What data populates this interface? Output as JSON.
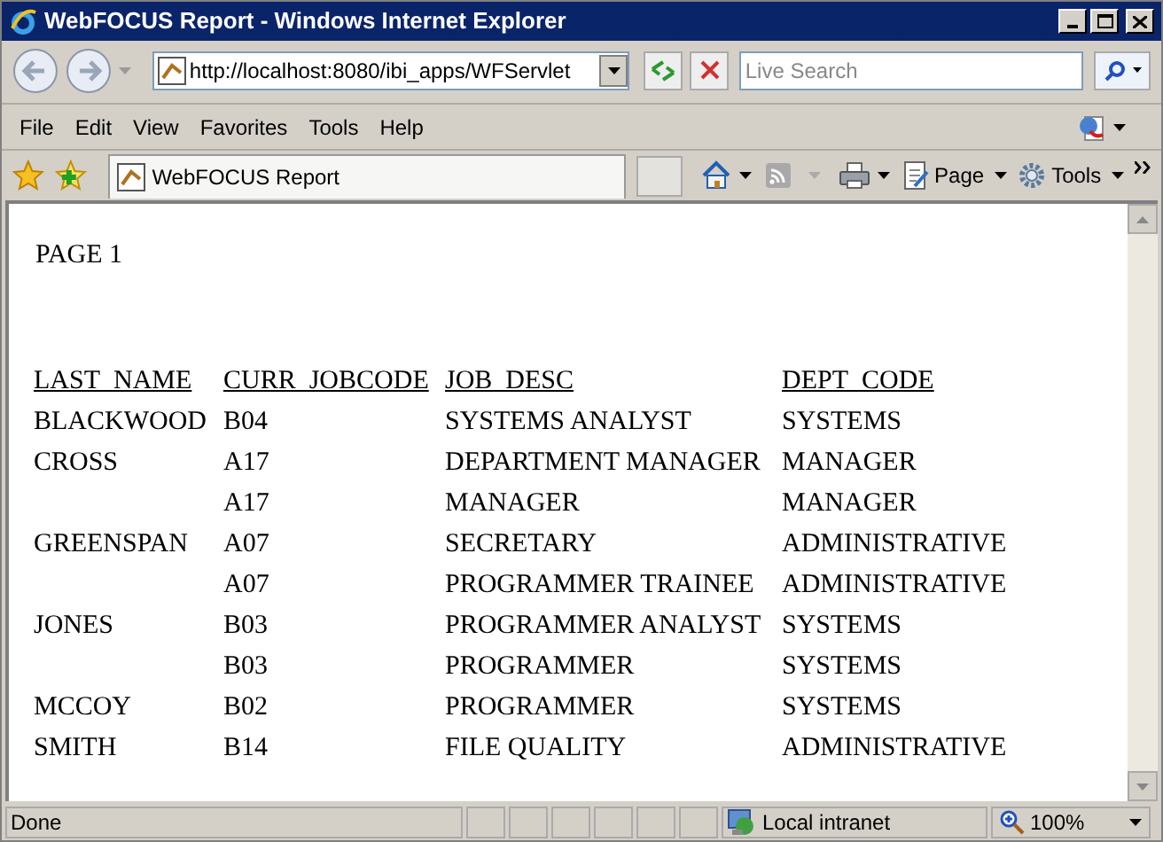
{
  "window": {
    "title": "WebFOCUS Report - Windows Internet Explorer"
  },
  "address_bar": {
    "value": "http://localhost:8080/ibi_apps/WFServlet"
  },
  "search": {
    "placeholder": "Live Search"
  },
  "menu": [
    "File",
    "Edit",
    "View",
    "Favorites",
    "Tools",
    "Help"
  ],
  "tab": {
    "label": "WebFOCUS Report"
  },
  "command_bar": [
    "Page",
    "Tools"
  ],
  "report": {
    "page_label": "PAGE 1",
    "columns": [
      "LAST_NAME",
      "CURR_JOBCODE",
      "JOB_DESC",
      "DEPT_CODE"
    ],
    "rows": [
      {
        "last_name": "BLACKWOOD",
        "curr_jobcode": "B04",
        "job_desc": "SYSTEMS ANALYST",
        "dept_code": "SYSTEMS"
      },
      {
        "last_name": "CROSS",
        "curr_jobcode": "A17",
        "job_desc": "DEPARTMENT MANAGER",
        "dept_code": "MANAGER"
      },
      {
        "curr_jobcode": "A17",
        "job_desc": "MANAGER",
        "dept_code": "MANAGER"
      },
      {
        "last_name": "GREENSPAN",
        "curr_jobcode": "A07",
        "job_desc": "SECRETARY",
        "dept_code": "ADMINISTRATIVE"
      },
      {
        "curr_jobcode": "A07",
        "job_desc": "PROGRAMMER TRAINEE",
        "dept_code": "ADMINISTRATIVE"
      },
      {
        "last_name": "JONES",
        "curr_jobcode": "B03",
        "job_desc": "PROGRAMMER ANALYST",
        "dept_code": "SYSTEMS"
      },
      {
        "curr_jobcode": "B03",
        "job_desc": "PROGRAMMER",
        "dept_code": "SYSTEMS"
      },
      {
        "last_name": "MCCOY",
        "curr_jobcode": "B02",
        "job_desc": "PROGRAMMER",
        "dept_code": "SYSTEMS"
      },
      {
        "last_name": "SMITH",
        "curr_jobcode": "B14",
        "job_desc": "FILE QUALITY",
        "dept_code": "ADMINISTRATIVE"
      }
    ]
  },
  "status_bar": {
    "text": "Done",
    "zone": "Local intranet",
    "zoom": "100%"
  }
}
